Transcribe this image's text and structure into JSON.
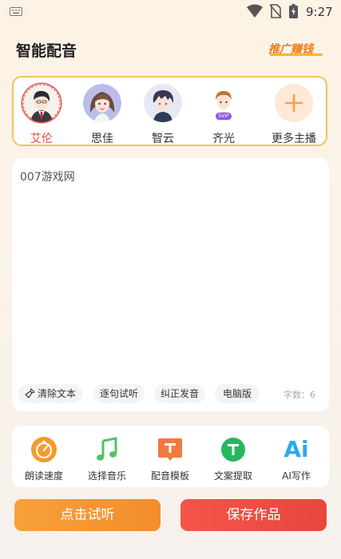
{
  "status_bar": {
    "time": "9:27"
  },
  "header": {
    "title": "智能配音",
    "promo_label": "推广赚钱"
  },
  "voices": [
    {
      "name": "艾伦",
      "selected": true
    },
    {
      "name": "思佳",
      "selected": false
    },
    {
      "name": "智云",
      "selected": false
    },
    {
      "name": "齐光",
      "selected": false,
      "badge": "SVIP"
    },
    {
      "name": "更多主播",
      "selected": false
    }
  ],
  "editor": {
    "text": "007游戏网",
    "tools": [
      "清除文本",
      "逐句试听",
      "纠正发音",
      "电脑版"
    ],
    "word_count": "字数：6"
  },
  "features": [
    {
      "label": "朗读速度",
      "icon": "speed-icon",
      "color": "#f39a2e"
    },
    {
      "label": "选择音乐",
      "icon": "music-icon",
      "color": "#4cc46a"
    },
    {
      "label": "配音模板",
      "icon": "template-icon",
      "color": "#f07a3c"
    },
    {
      "label": "文案提取",
      "icon": "text-extract-icon",
      "color": "#27b85f"
    },
    {
      "label": "AI写作",
      "icon": "ai-icon",
      "color": "#2ea8f0",
      "icon_text": "Ai"
    }
  ],
  "actions": {
    "listen": "点击试听",
    "save": "保存作品"
  },
  "colors": {
    "accent_orange": "#f48c2c",
    "accent_red": "#e8463e",
    "selected_name": "#e04c3c"
  }
}
